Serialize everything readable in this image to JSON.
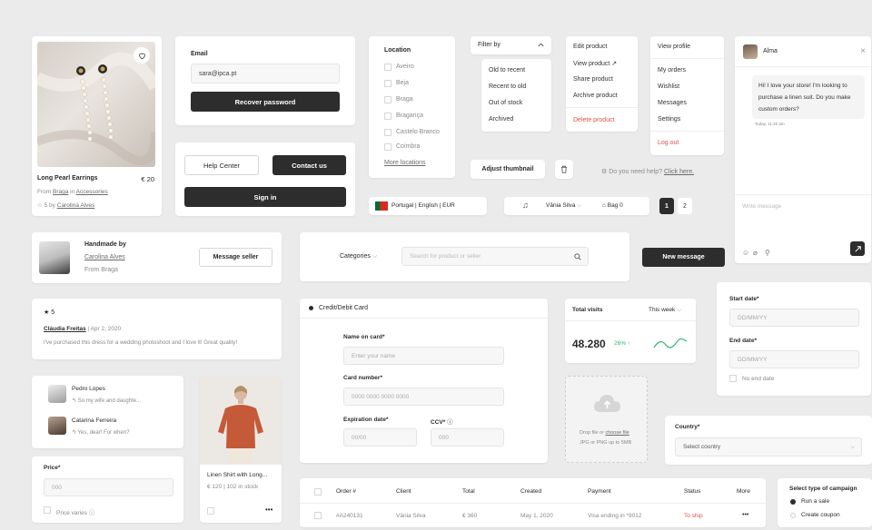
{
  "product_card": {
    "title": "Long Pearl Earrings",
    "price": "€ 20",
    "from_prefix": "From",
    "from_place": "Braga",
    "in_word": "in",
    "category": "Accessories",
    "rating_by": "5 by",
    "rating_author": "Carolina Alves"
  },
  "email_form": {
    "label": "Email",
    "value": "sara@ipca.pt",
    "button": "Recover password"
  },
  "auth_buttons": {
    "help": "Help Center",
    "contact": "Contact us",
    "signin": "Sign in"
  },
  "location": {
    "title": "Location",
    "items": [
      "Aveiro",
      "Beja",
      "Braga",
      "Bragança",
      "Castelo Branco",
      "Coimbra"
    ],
    "more": "More locations"
  },
  "filter": {
    "label": "Filter by",
    "options": [
      "Old to recent",
      "Recent to old",
      "Out of stock",
      "Archived"
    ]
  },
  "product_menu": {
    "items": [
      "Edit product",
      "View product",
      "Share product",
      "Archive product"
    ],
    "delete": "Delete product"
  },
  "profile_menu": {
    "items": [
      "View profile",
      "My orders",
      "Wishlist",
      "Messages",
      "Settings"
    ],
    "logout": "Log out"
  },
  "chat": {
    "name": "Alma",
    "message": "Hi! I love your store! I'm looking to purchase a linen suit. Do you make custom orders?",
    "time": "Today, 11:20 am",
    "placeholder": "Write message"
  },
  "toolbar_row": {
    "adjust": "Adjust thumbnail",
    "help_text": "Do you need help?",
    "help_link": "Click here.",
    "locale": "Portugal | English | EUR",
    "user": "Vânia Silva",
    "bag": "Bag 0",
    "pages": [
      "1",
      "2"
    ]
  },
  "seller": {
    "title": "Handmade by",
    "name": "Carolina Alves",
    "from": "From Braga",
    "button": "Message seller"
  },
  "search_bar": {
    "categories": "Categories",
    "placeholder": "Search for product or seller",
    "new_message": "New message"
  },
  "review": {
    "rating": "5",
    "author": "Cláudia Freitas",
    "date": "| Apr 2, 2020",
    "text": "I've purchased this dress for a wedding photoshoot and I love it! Great quality!"
  },
  "payment": {
    "method": "Credit/Debit Card",
    "name_label": "Name on card*",
    "name_placeholder": "Enter your name",
    "number_label": "Card number*",
    "number_placeholder": "0000 0000 0000 0000",
    "exp_label": "Expiration date*",
    "exp_placeholder": "00/00",
    "ccv_label": "CCV*",
    "ccv_placeholder": "000"
  },
  "visits": {
    "title": "Total visits",
    "period": "This week",
    "value": "48.280",
    "change": "26% ↑"
  },
  "dates": {
    "start_label": "Start date*",
    "start_placeholder": "DD/MM/YY",
    "end_label": "End date*",
    "end_placeholder": "DD/MM/YY",
    "no_end": "No end date"
  },
  "conversations": [
    {
      "name": "Pedro Lopes",
      "preview": "So my wife and daughte..."
    },
    {
      "name": "Catarina Ferreira",
      "preview": "Yes, dear! For when?"
    }
  ],
  "shirt_card": {
    "title": "Linen Shirt with Long...",
    "meta": "€ 120 | 102 in stock"
  },
  "upload": {
    "text": "Drop file or",
    "link": "choose file",
    "hint": "JPG or PNG up to 5MB"
  },
  "country": {
    "label": "Country*",
    "placeholder": "Select country"
  },
  "price_field": {
    "label": "Price*",
    "placeholder": "000",
    "varies": "Price varies"
  },
  "orders_table": {
    "headers": [
      "Order #",
      "Client",
      "Total",
      "Created",
      "Payment",
      "Status",
      "More"
    ],
    "row": [
      "#A240131",
      "Vânia Silva",
      "€ 360",
      "May 1, 2020",
      "Visa ending in *9012",
      "To ship",
      "•••"
    ]
  },
  "campaign": {
    "title": "Select type of campaign",
    "options": [
      "Run a sale",
      "Create coupon"
    ]
  },
  "colors": {
    "dark": "#2d2d2d",
    "danger": "#e0524a",
    "success": "#2bb673",
    "background": "#ebebeb"
  }
}
